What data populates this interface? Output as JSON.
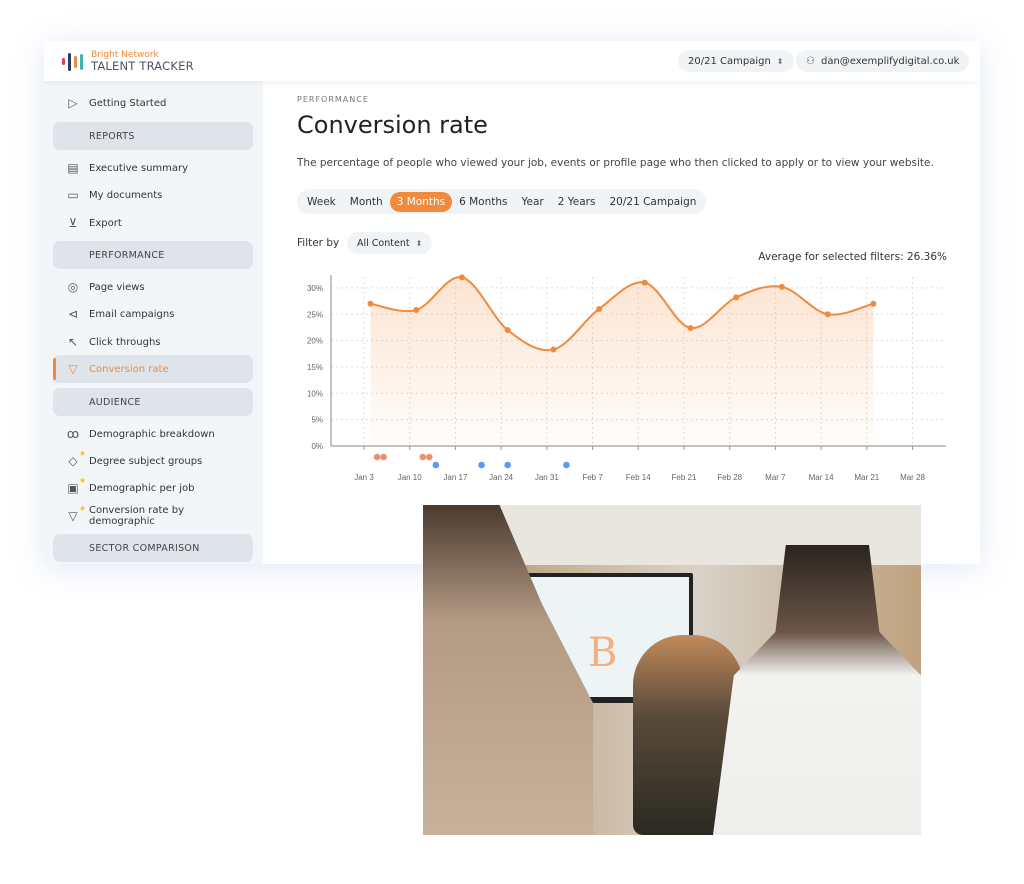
{
  "header": {
    "brand_top": "Bright Network",
    "brand_bottom": "TALENT TRACKER",
    "campaign_select": "20/21 Campaign",
    "user_email": "dan@exemplifydigital.co.uk"
  },
  "sidebar": {
    "getting_started": "Getting Started",
    "sections": {
      "reports": "REPORTS",
      "performance": "PERFORMANCE",
      "audience": "AUDIENCE",
      "sector": "SECTOR COMPARISON"
    },
    "reports": [
      "Executive summary",
      "My documents",
      "Export"
    ],
    "performance": [
      "Page views",
      "Email campaigns",
      "Click throughs",
      "Conversion rate"
    ],
    "audience": [
      "Demographic breakdown",
      "Degree subject groups",
      "Demographic per job",
      "Conversion rate by demographic"
    ]
  },
  "main": {
    "breadcrumb": "PERFORMANCE",
    "title": "Conversion rate",
    "description": "The percentage of people who viewed your job, events or profile page who then clicked to apply or to view your website.",
    "ranges": [
      "Week",
      "Month",
      "3 Months",
      "6 Months",
      "Year",
      "2 Years",
      "20/21 Campaign"
    ],
    "active_range": "3 Months",
    "filter_label": "Filter by",
    "filter_value": "All Content",
    "average": "Average for selected filters: 26.36%"
  },
  "colors": {
    "accent": "#f08a3c",
    "event_orange": "#f0906a",
    "event_blue": "#5b9af5"
  },
  "chart_data": {
    "type": "area",
    "ylim": [
      0,
      32
    ],
    "y_ticks": [
      "0%",
      "5%",
      "10%",
      "15%",
      "20%",
      "25%",
      "30%"
    ],
    "y_tick_values": [
      0,
      5,
      10,
      15,
      20,
      25,
      30
    ],
    "x_ticks": [
      "Jan 3",
      "Jan 10",
      "Jan 17",
      "Jan 24",
      "Jan 31",
      "Feb 7",
      "Feb 14",
      "Feb 21",
      "Feb 28",
      "Mar 7",
      "Mar 14",
      "Mar 21",
      "Mar 28"
    ],
    "x": [
      "Jan 4",
      "Jan 11",
      "Jan 18",
      "Jan 25",
      "Feb 1",
      "Feb 8",
      "Feb 15",
      "Feb 22",
      "Mar 1",
      "Mar 8",
      "Mar 15",
      "Mar 22"
    ],
    "values": [
      27,
      25.8,
      32,
      22,
      18.3,
      26,
      31,
      22.4,
      28.2,
      30.2,
      25,
      27
    ],
    "grid": true,
    "event_markers": {
      "orange": [
        "Jan 5",
        "Jan 6",
        "Jan 12",
        "Jan 13"
      ],
      "blue": [
        "Jan 14",
        "Jan 21",
        "Jan 25",
        "Feb 3"
      ]
    }
  }
}
